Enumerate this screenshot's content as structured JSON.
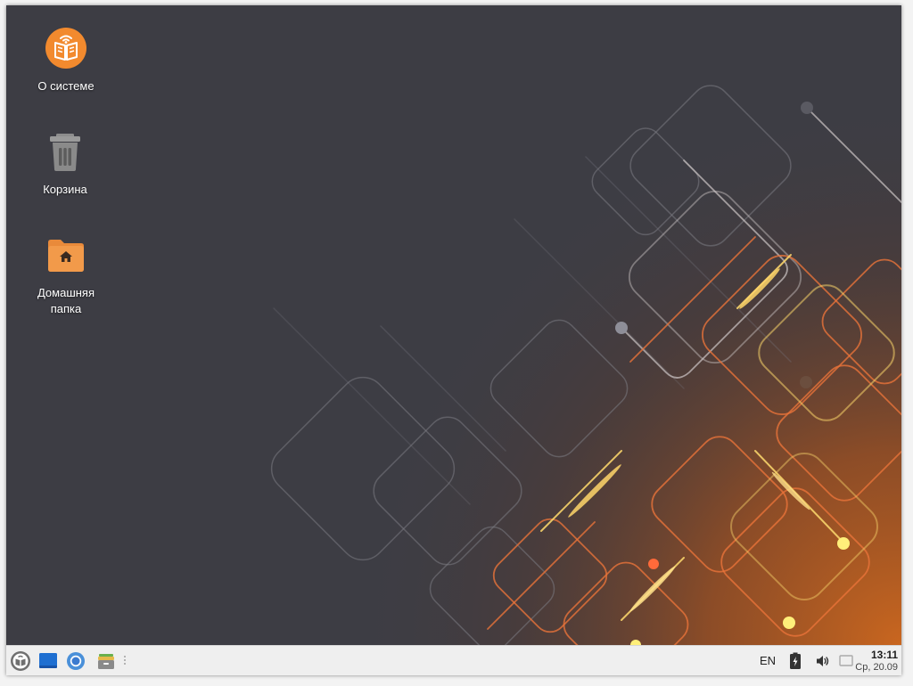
{
  "desktop": {
    "icons": [
      {
        "label": "О системе",
        "icon": "about-system-book-icon"
      },
      {
        "label": "Корзина",
        "icon": "trash-icon"
      },
      {
        "label": "Домашняя\nпапка",
        "icon": "home-folder-icon"
      }
    ]
  },
  "taskbar": {
    "apps": [
      {
        "icon": "start-menu-icon"
      },
      {
        "icon": "show-desktop-icon"
      },
      {
        "icon": "chromium-browser-icon"
      },
      {
        "icon": "file-manager-icon"
      }
    ],
    "tray": {
      "keyboard_layout": "EN",
      "battery_icon": "battery-charging-icon",
      "volume_icon": "volume-icon",
      "notifications_icon": "notifications-icon",
      "clock_time": "13:11",
      "clock_date": "Ср, 20.09"
    }
  },
  "colors": {
    "desktop_bg": "#3d3d44",
    "accent_orange": "#f28a2e",
    "taskbar_bg": "#efefef"
  }
}
